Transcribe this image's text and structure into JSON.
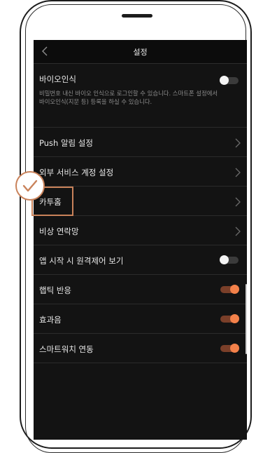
{
  "header": {
    "title": "설정"
  },
  "biometric": {
    "label": "바이오인식",
    "description": "비밀번호 내신 바이오 인식으로 로그인할 수 있습니다. 스마트폰 설정에서 바이오인식(지문 등) 등록을 하실 수 있습니다.",
    "toggle_state": "off"
  },
  "nav_items": [
    {
      "label": "Push 알림 설정"
    },
    {
      "label": "외부 서비스 계정 설정"
    },
    {
      "label": "카투홈"
    },
    {
      "label": "비상 연락망"
    }
  ],
  "toggle_items": [
    {
      "label": "앱 시작 시 원격제어 보기",
      "state": "off"
    },
    {
      "label": "햅틱 반응",
      "state": "on"
    },
    {
      "label": "효과음",
      "state": "on"
    },
    {
      "label": "스마트워치 연동",
      "state": "on"
    }
  ],
  "icons": {
    "back": "chevron-left-icon",
    "row_arrow": "chevron-right-icon",
    "callout": "check-icon"
  },
  "colors": {
    "accent": "#f3814a",
    "highlight": "#c9825a",
    "screen_bg": "#131313"
  }
}
